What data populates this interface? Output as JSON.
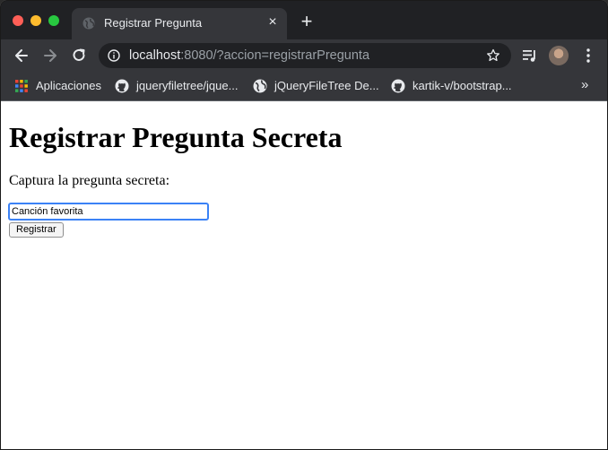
{
  "browser": {
    "tab": {
      "title": "Registrar Pregunta",
      "close_glyph": "×",
      "favicon": "globe-icon"
    },
    "new_tab_glyph": "+",
    "url": {
      "host": "localhost",
      "rest": ":8080/?accion=registrarPregunta"
    },
    "bookmarks": [
      {
        "label": "Aplicaciones",
        "icon": "apps-grid-icon"
      },
      {
        "label": "jqueryfiletree/jque...",
        "icon": "github-icon"
      },
      {
        "label": "jQueryFileTree De...",
        "icon": "globe-icon"
      },
      {
        "label": "kartik-v/bootstrap...",
        "icon": "github-icon"
      }
    ],
    "bookmarks_more": "»"
  },
  "page": {
    "title": "Registrar Pregunta Secreta",
    "prompt": "Captura la pregunta secreta:",
    "input_value": "Canción favorita",
    "submit_label": "Registrar"
  },
  "colors": {
    "tab_strip": "#202124",
    "toolbar": "#35363a",
    "focus_ring": "#3b82f6"
  }
}
